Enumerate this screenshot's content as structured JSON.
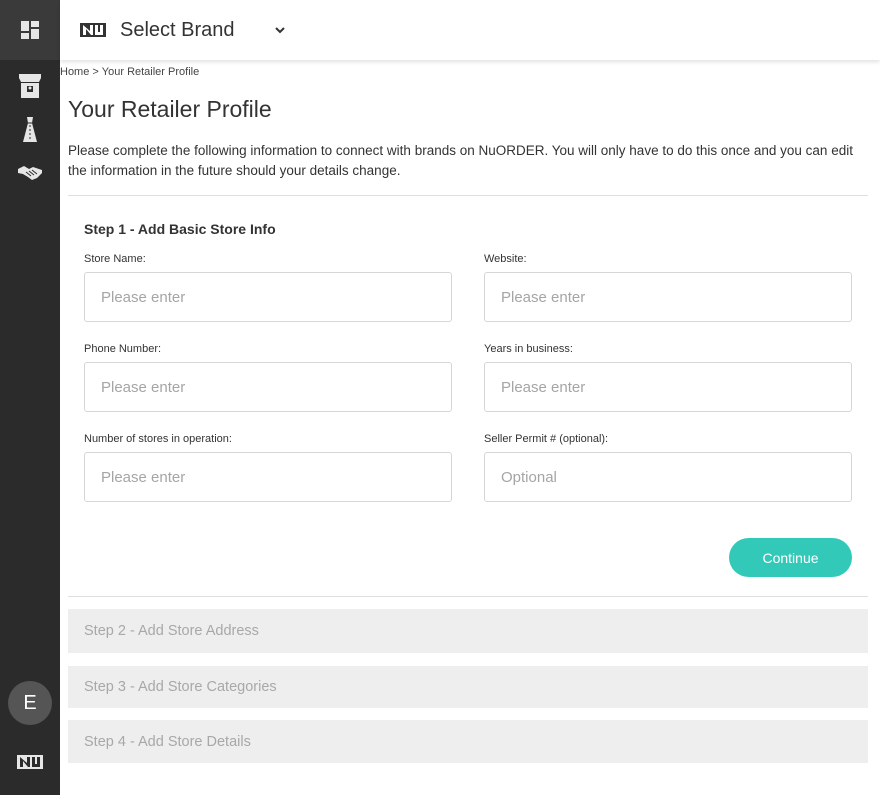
{
  "header": {
    "brand_select_label": "Select Brand"
  },
  "sidebar": {
    "avatar_initial": "E"
  },
  "breadcrumb": {
    "home": "Home",
    "separator": ">",
    "current": "Your Retailer Profile"
  },
  "page": {
    "title": "Your Retailer Profile",
    "intro": "Please complete the following information to connect with brands on NuORDER. You will only have to do this once and you can edit the information in the future should your details change."
  },
  "step1": {
    "title": "Step 1 - Add Basic Store Info",
    "fields": [
      {
        "label": "Store Name:",
        "placeholder": "Please enter",
        "value": ""
      },
      {
        "label": "Website:",
        "placeholder": "Please enter",
        "value": ""
      },
      {
        "label": "Phone Number:",
        "placeholder": "Please enter",
        "value": ""
      },
      {
        "label": "Years in business:",
        "placeholder": "Please enter",
        "value": ""
      },
      {
        "label": "Number of stores in operation:",
        "placeholder": "Please enter",
        "value": ""
      },
      {
        "label": "Seller Permit # (optional):",
        "placeholder": "Optional",
        "value": ""
      }
    ],
    "continue_label": "Continue"
  },
  "steps_collapsed": [
    {
      "label": "Step 2 - Add Store Address"
    },
    {
      "label": "Step 3 - Add Store Categories"
    },
    {
      "label": "Step 4 - Add Store Details"
    }
  ],
  "colors": {
    "sidebar": "#2b2b2b",
    "accent": "#33c9b9",
    "collapsed_bg": "#eeeeee"
  }
}
